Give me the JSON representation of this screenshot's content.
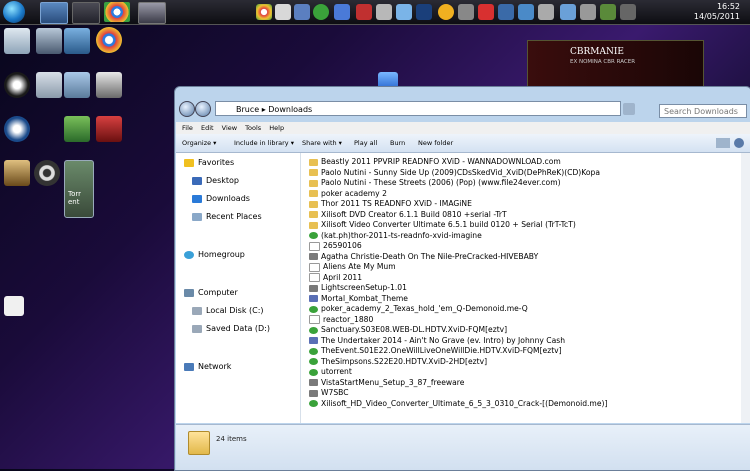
{
  "clock": {
    "time": "16:52",
    "date": "14/05/2011"
  },
  "desktop_icons": [
    {
      "name": "recycle-bin-icon"
    },
    {
      "name": "computer-icon"
    },
    {
      "name": "network-icon"
    },
    {
      "name": "chrome-icon"
    },
    {
      "name": "desktop-app-icon-1"
    },
    {
      "name": "desktop-app-icon-2"
    },
    {
      "name": "desktop-app-icon-3"
    },
    {
      "name": "desktop-app-icon-4"
    },
    {
      "name": "desktop-app-icon-5"
    },
    {
      "name": "desktop-app-icon-6"
    },
    {
      "name": "desktop-app-icon-7"
    },
    {
      "name": "desktop-app-icon-8"
    }
  ],
  "desktop_selected_label": "Torr ent",
  "widget": {
    "title": "CBRMANIE",
    "subtitle": "EX NOMINA CBR RACER"
  },
  "window": {
    "address": "Bruce ▸ Downloads",
    "search_placeholder": "Search Downloads",
    "menu": [
      "File",
      "Edit",
      "View",
      "Tools",
      "Help"
    ],
    "toolbar": [
      "Organize ▾",
      "Include in library ▾",
      "Share with ▾",
      "Play all",
      "Burn",
      "New folder"
    ],
    "nav": {
      "favorites": "Favorites",
      "desktop": "Desktop",
      "downloads": "Downloads",
      "recent": "Recent Places",
      "homegroup": "Homegroup",
      "computer": "Computer",
      "local_disk": "Local Disk (C:)",
      "saved_data": "Saved Data (D:)",
      "network": "Network"
    },
    "files": [
      {
        "name": "Beastly 2011 PPVRIP READNFO XViD - WANNADOWNLOAD.com",
        "type": "folder"
      },
      {
        "name": "Paolo Nutini - Sunny Side Up (2009)CDsSkedVid_XviD(DePhReK)(CD)Kopa",
        "type": "folder"
      },
      {
        "name": "Paolo Nutini - These Streets (2006) (Pop) (www.file24ever.com)",
        "type": "folder"
      },
      {
        "name": "poker academy 2",
        "type": "folder"
      },
      {
        "name": "Thor 2011 TS READNFO XViD - IMAGiNE",
        "type": "folder"
      },
      {
        "name": "Xilisoft DVD Creator 6.1.1 Build 0810 +serial -TrT",
        "type": "folder"
      },
      {
        "name": "Xilisoft Video Converter Ultimate 6.5.1 build 0120 + Serial (TrT-TcT)",
        "type": "folder"
      },
      {
        "name": "(kat.ph)thor-2011-ts-readnfo-xvid-imagine",
        "type": "torrent"
      },
      {
        "name": "26590106",
        "type": "file"
      },
      {
        "name": "Agatha Christie-Death On The Nile-PreCracked-HIVEBABY",
        "type": "app"
      },
      {
        "name": "Aliens Ate My Mum",
        "type": "file"
      },
      {
        "name": "April 2011",
        "type": "file"
      },
      {
        "name": "LightscreenSetup-1.01",
        "type": "app"
      },
      {
        "name": "Mortal_Kombat_Theme",
        "type": "media"
      },
      {
        "name": "poker_academy_2_Texas_hold_'em_Q-Demonoid.me-Q",
        "type": "torrent"
      },
      {
        "name": "reactor_1880",
        "type": "file"
      },
      {
        "name": "Sanctuary.S03E08.WEB-DL.HDTV.XviD-FQM[eztv]",
        "type": "torrent"
      },
      {
        "name": "The Undertaker 2014 - Ain't No Grave (ev. Intro) by Johnny Cash",
        "type": "media"
      },
      {
        "name": "TheEvent.S01E22.OneWillLiveOneWillDie.HDTV.XviD-FQM[eztv]",
        "type": "torrent"
      },
      {
        "name": "TheSimpsons.S22E20.HDTV.XviD-2HD[eztv]",
        "type": "torrent"
      },
      {
        "name": "utorrent",
        "type": "torrent"
      },
      {
        "name": "VistaStartMenu_Setup_3_87_freeware",
        "type": "app"
      },
      {
        "name": "W7SBC",
        "type": "app"
      },
      {
        "name": "Xilisoft_HD_Video_Converter_Ultimate_6_5_3_0310_Crack-[(Demonoid.me)]",
        "type": "torrent"
      }
    ],
    "status": "24 items"
  },
  "colors": {
    "folder": "#e8c052",
    "torrent": "#3aa23a",
    "file": "#ffffff",
    "app": "#7a7a7a",
    "media": "#5a6fb5"
  }
}
